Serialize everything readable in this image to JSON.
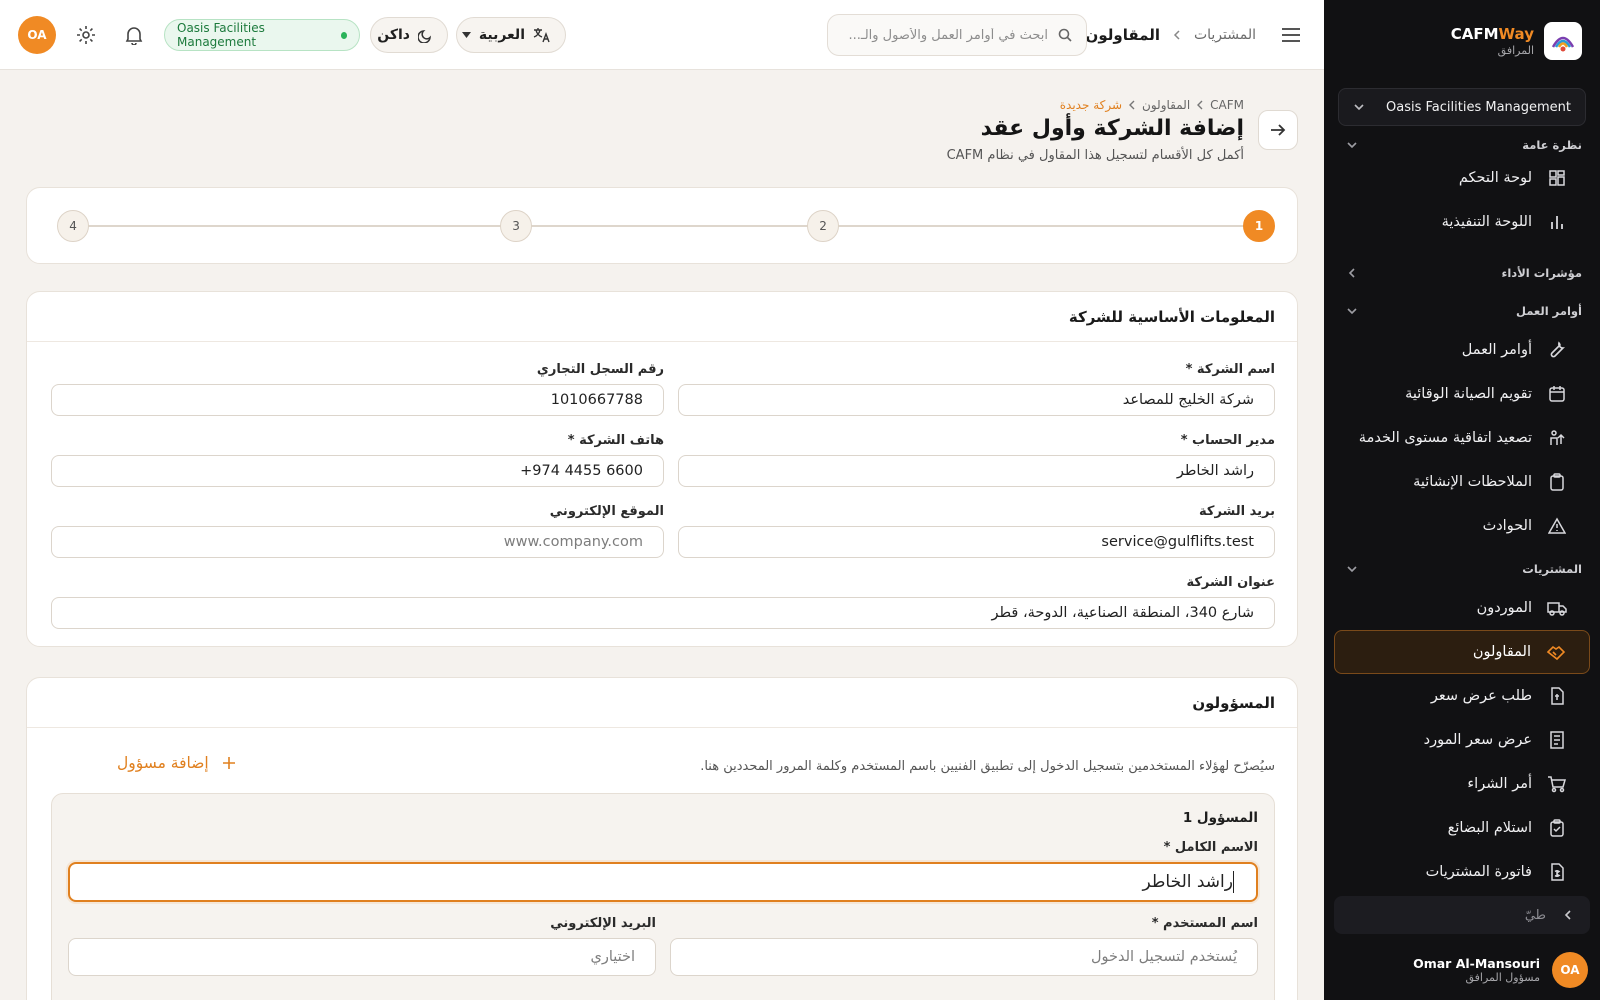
{
  "brand": {
    "name_main": "CAFM",
    "name_accent": "Way",
    "subtitle": "المرافق"
  },
  "sidebar": {
    "org_selector": "Oasis Facilities Management",
    "sections": [
      {
        "label": "نظرة عامة",
        "items": [
          {
            "label": "لوحة التحكم",
            "icon": "dashboard-icon"
          },
          {
            "label": "اللوحة التنفيذية",
            "icon": "bar-chart-icon"
          }
        ]
      },
      {
        "label": "مؤشرات الأداء",
        "items": []
      },
      {
        "label": "أوامر العمل",
        "items": [
          {
            "label": "أوامر العمل",
            "icon": "wrench-icon"
          },
          {
            "label": "تقويم الصيانة الوقائية",
            "icon": "calendar-icon"
          },
          {
            "label": "تصعيد اتفاقية مستوى الخدمة",
            "icon": "escalation-icon"
          },
          {
            "label": "الملاحظات الإنشائية",
            "icon": "clipboard-icon"
          },
          {
            "label": "الحوادث",
            "icon": "warning-icon"
          }
        ]
      },
      {
        "label": "المشتريات",
        "items": [
          {
            "label": "الموردون",
            "icon": "truck-icon"
          },
          {
            "label": "المقاولون",
            "icon": "handshake-icon",
            "active": true
          },
          {
            "label": "طلب عرض سعر",
            "icon": "quote-request-icon"
          },
          {
            "label": "عرض سعر المورد",
            "icon": "receipt-icon"
          },
          {
            "label": "أمر الشراء",
            "icon": "cart-icon"
          },
          {
            "label": "استلام البضائع",
            "icon": "clipboard-check-icon"
          },
          {
            "label": "فاتورة المشتريات",
            "icon": "invoice-icon"
          }
        ]
      }
    ],
    "collapse_label": "طيّ",
    "user": {
      "initials": "OA",
      "name": "Omar Al-Mansouri",
      "role": "مسؤول المرافق"
    }
  },
  "header": {
    "breadcrumb_parent": "المشتريات",
    "breadcrumb_current": "المقاولون",
    "search_placeholder": "ابحث في أوامر العمل والأصول والـ...",
    "language_label": "العربية",
    "theme_label": "داكن",
    "org_badge": "Oasis Facilities Management",
    "avatar_initials": "OA"
  },
  "page": {
    "breadcrumbs": [
      "CAFM",
      "المقاولون",
      "شركة جديدة"
    ],
    "title": "إضافة الشركة وأول عقد",
    "subtitle": "أكمل كل الأقسام لتسجيل هذا المقاول في نظام CAFM",
    "steps": [
      "1",
      "2",
      "3",
      "4"
    ],
    "active_step": 1
  },
  "basic_info": {
    "title": "المعلومات الأساسية للشركة",
    "company_name": {
      "label": "اسم الشركة *",
      "value": "شركة الخليج للمصاعد"
    },
    "cr_number": {
      "label": "رقم السجل التجاري",
      "value": "1010667788"
    },
    "account_manager": {
      "label": "مدير الحساب *",
      "value": "راشد الخاطر"
    },
    "company_phone": {
      "label": "هاتف الشركة *",
      "value": "+974 4455 6600"
    },
    "company_email": {
      "label": "بريد الشركة",
      "value": "service@gulflifts.test"
    },
    "website": {
      "label": "الموقع الإلكتروني",
      "placeholder": "www.company.com"
    },
    "address": {
      "label": "عنوان الشركة",
      "value": "شارع 340، المنطقة الصناعية، الدوحة، قطر"
    }
  },
  "responsibles": {
    "title": "المسؤولون",
    "note": "سيُصرّح لهؤلاء المستخدمين بتسجيل الدخول إلى تطبيق الفنيين باسم المستخدم وكلمة المرور المحددين هنا.",
    "add_label": "إضافة مسؤول",
    "entry_title": "المسؤول 1",
    "full_name": {
      "label": "الاسم الكامل *",
      "value": "راشد الخاطر"
    },
    "username": {
      "label": "اسم المستخدم *",
      "placeholder": "يُستخدم لتسجيل الدخول"
    },
    "email": {
      "label": "البريد الإلكتروني",
      "placeholder": "اختياري"
    }
  }
}
